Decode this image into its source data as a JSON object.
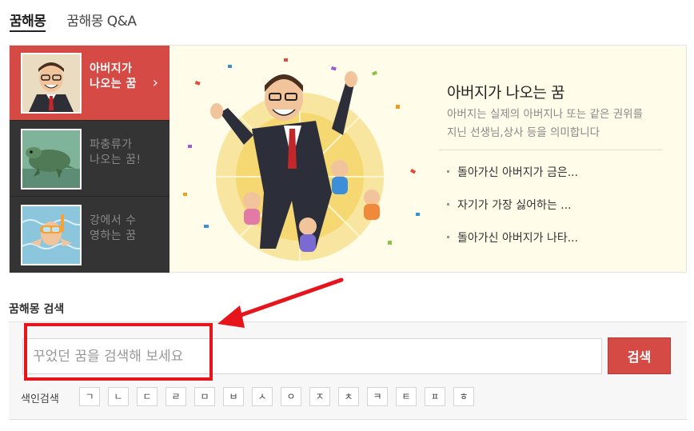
{
  "tabs": [
    {
      "label": "꿈해몽",
      "active": true
    },
    {
      "label": "꿈해몽 Q&A",
      "active": false
    }
  ],
  "side_items": [
    {
      "label": "아버지가 나오는 꿈",
      "thumb": "father-thumb"
    },
    {
      "label": "파충류가 나오는 꿈!",
      "thumb": "reptile-thumb"
    },
    {
      "label": "강에서 수영하는 꿈",
      "thumb": "swim-thumb"
    }
  ],
  "feature": {
    "title": "아버지가 나오는 꿈",
    "description": "아버지는 실제의 아버지나 또는 같은 권위를 지닌 선생님,상사 등을 의미합니다",
    "links": [
      "돌아가신 아버지가 금은...",
      "자기가 가장 싫어하는 ...",
      "돌아가신 아버지가 나타..."
    ]
  },
  "search": {
    "title": "꿈해몽 검색",
    "placeholder": "꾸었던 꿈을 검색해 보세요",
    "button_label": "검색",
    "index_label": "색인검색",
    "index_keys": [
      "ㄱ",
      "ㄴ",
      "ㄷ",
      "ㄹ",
      "ㅁ",
      "ㅂ",
      "ㅅ",
      "ㅇ",
      "ㅈ",
      "ㅊ",
      "ㅋ",
      "ㅌ",
      "ㅍ",
      "ㅎ"
    ]
  },
  "colors": {
    "accent": "#d64a45",
    "sidebar_bg": "#343434",
    "feature_bg": "#fffde9",
    "annotation": "#e8141b"
  }
}
